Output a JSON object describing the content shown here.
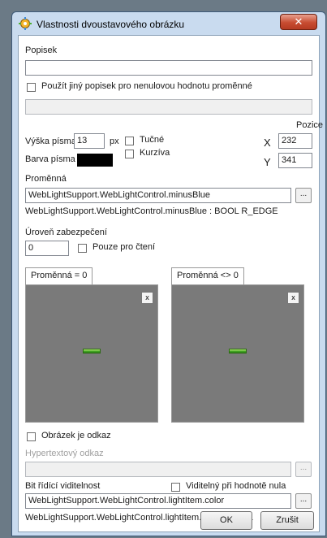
{
  "window": {
    "title": "Vlastnosti dvoustavového obrázku",
    "close_glyph": "✕",
    "icon": "app-gear-icon"
  },
  "label": {
    "caption": "Popisek",
    "value": "",
    "alt_checkbox_label": "Použít jiný popisek pro nenulovou hodnotu proměnné",
    "alt_checked": false,
    "alt_value": ""
  },
  "font": {
    "height_label": "Výška písma",
    "height_value": "13",
    "height_unit": "px",
    "color_label": "Barva písma",
    "color": "#000000",
    "bold_label": "Tučné",
    "bold_checked": false,
    "italic_label": "Kurzíva",
    "italic_checked": false
  },
  "position": {
    "caption": "Pozice",
    "x_label": "X",
    "x_value": "232",
    "y_label": "Y",
    "y_value": "341"
  },
  "variable": {
    "caption": "Proměnná",
    "value": "WebLightSupport.WebLightControl.minusBlue",
    "browse_label": "...",
    "info": "WebLightSupport.WebLightControl.minusBlue : BOOL R_EDGE"
  },
  "security": {
    "caption": "Úroveň zabezpečení",
    "value": "0",
    "readonly_label": "Pouze pro čtení",
    "readonly_checked": false
  },
  "images": {
    "tab_zero": "Proměnná = 0",
    "tab_nonzero": "Proměnná <> 0",
    "remove_glyph": "x",
    "background": "#7a7a7a",
    "indicator_color": "#3ea321"
  },
  "link": {
    "is_link_label": "Obrázek je odkaz",
    "is_link_checked": false,
    "hyperlink_caption": "Hypertextový odkaz",
    "hyperlink_value": "",
    "browse_label": "..."
  },
  "visibility": {
    "caption": "Bit řídící viditelnost",
    "visible_zero_label": "Viditelný při hodnotě nula",
    "visible_zero_checked": false,
    "value": "WebLightSupport.WebLightControl.lightItem.color",
    "browse_label": "...",
    "info": "WebLightSupport.WebLightControl.lightItem.color : BOOL"
  },
  "buttons": {
    "ok": "OK",
    "cancel": "Zrušit"
  }
}
